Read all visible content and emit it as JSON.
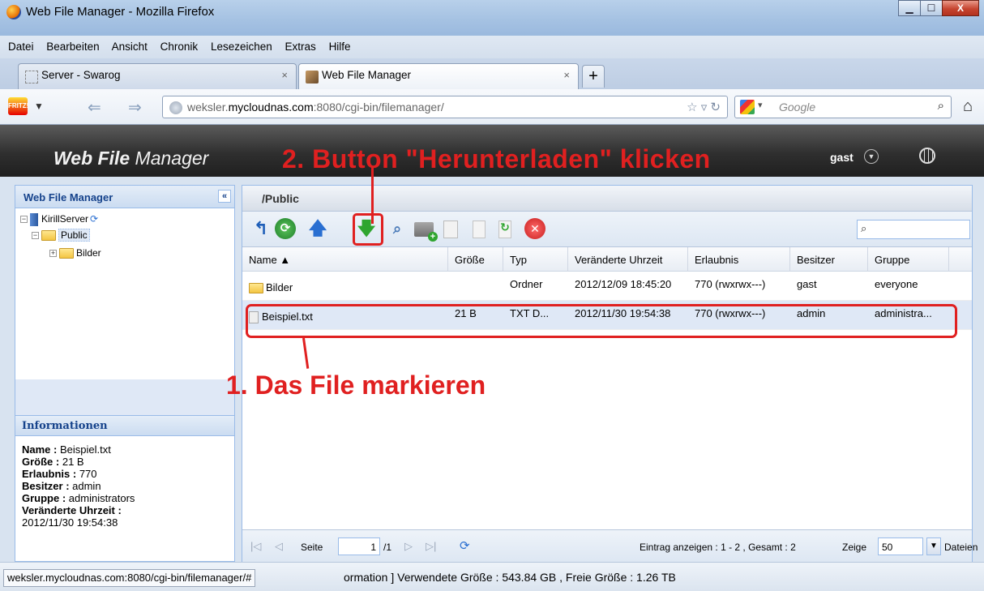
{
  "window": {
    "title": "Web File Manager - Mozilla Firefox",
    "min": "▁",
    "max": "☐",
    "close": "X"
  },
  "menu": [
    "Datei",
    "Bearbeiten",
    "Ansicht",
    "Chronik",
    "Lesezeichen",
    "Extras",
    "Hilfe"
  ],
  "tabs": [
    {
      "label": "Server - Swarog",
      "close": "×"
    },
    {
      "label": "Web File Manager",
      "close": "×"
    }
  ],
  "newtab": "+",
  "nav": {
    "url_host_pre": "weksler.",
    "url_host_bold": "mycloudnas.com",
    "url_rest": ":8080/cgi-bin/filemanager/",
    "search_placeholder": "Google",
    "fritz_label": "FRITZ!"
  },
  "app": {
    "logo_bold": "Web File",
    "logo_rest": " Manager",
    "user": "gast",
    "annotation_step2": "2. Button \"Herunterladen\" klicken",
    "annotation_step1": "1. Das File markieren"
  },
  "left": {
    "title": "Web File Manager",
    "collapse": "«",
    "tree": [
      {
        "label": "KirillServer",
        "level": 0,
        "toggle": "⊟"
      },
      {
        "label": "Public",
        "level": 1,
        "toggle": "⊟"
      },
      {
        "label": "Bilder",
        "level": 2,
        "toggle": "⊞"
      }
    ],
    "info_title": "Informationen",
    "info": [
      {
        "key": "Name",
        "value": "Beispiel.txt"
      },
      {
        "key": "Größe",
        "value": "21 B"
      },
      {
        "key": "Erlaubnis",
        "value": "770"
      },
      {
        "key": "Besitzer",
        "value": "admin"
      },
      {
        "key": "Gruppe",
        "value": "administrators"
      },
      {
        "key": "Veränderte Uhrzeit",
        "value": "2012/11/30 19:54:38"
      }
    ]
  },
  "right": {
    "path": "/Public",
    "filter_icon": "🔍",
    "columns": [
      "Name ▲",
      "Größe",
      "Typ",
      "Veränderte Uhrzeit",
      "Erlaubnis",
      "Besitzer",
      "Gruppe"
    ],
    "rows": [
      {
        "name": "Bilder",
        "size": "",
        "type": "Ordner",
        "modified": "2012/12/09 18:45:20",
        "perm": "770 (rwxrwx---)",
        "owner": "gast",
        "group": "everyone",
        "kind": "folder"
      },
      {
        "name": "Beispiel.txt",
        "size": "21 B",
        "type": "TXT D...",
        "modified": "2012/11/30 19:54:38",
        "perm": "770 (rwxrwx---)",
        "owner": "admin",
        "group": "administra...",
        "kind": "file"
      }
    ],
    "pager": {
      "page_label": "Seite",
      "page_value": "1",
      "page_total": "/1",
      "entries": "Eintrag anzeigen : 1 - 2 , Gesamt : 2",
      "show_label": "Zeige",
      "show_value": "50",
      "unit": "Dateien"
    }
  },
  "status": {
    "url": "weksler.mycloudnas.com:8080/cgi-bin/filemanager/#",
    "text": "ormation ] Verwendete Größe : 543.84 GB , Freie Größe : 1.26 TB"
  }
}
